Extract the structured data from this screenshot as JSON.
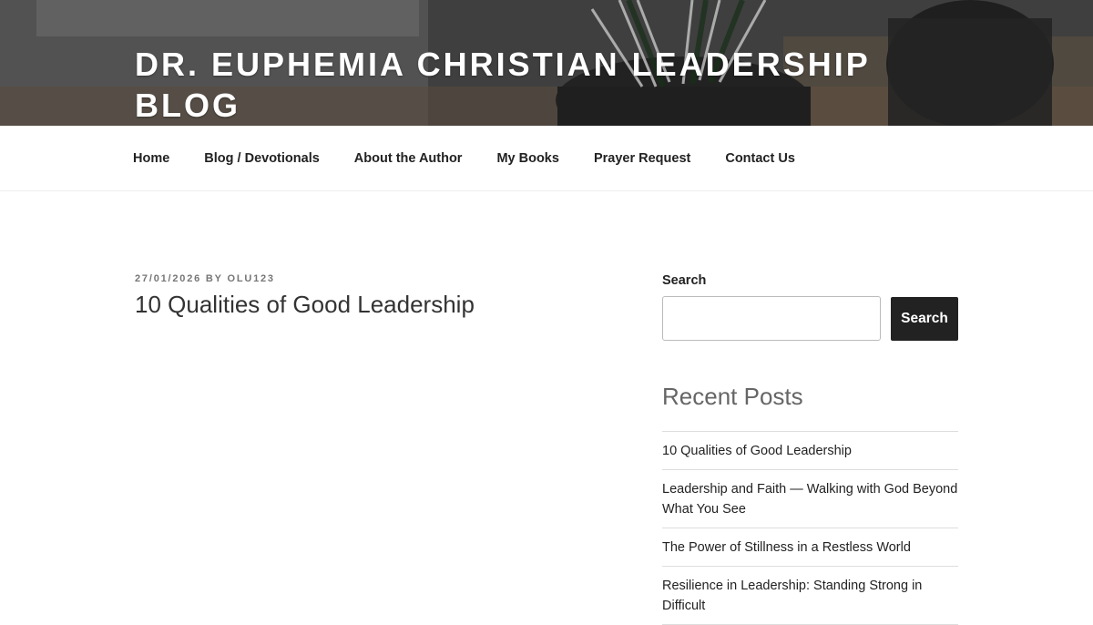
{
  "site": {
    "title": "DR. EUPHEMIA CHRISTIAN LEADERSHIP BLOG"
  },
  "nav": {
    "items": [
      {
        "label": "Home"
      },
      {
        "label": "Blog / Devotionals"
      },
      {
        "label": "About the Author"
      },
      {
        "label": "My Books"
      },
      {
        "label": "Prayer Request"
      },
      {
        "label": "Contact Us"
      }
    ]
  },
  "post": {
    "date": "27/01/2026",
    "by": "BY",
    "author": "OLU123",
    "title": "10 Qualities of Good Leadership"
  },
  "sidebar": {
    "search": {
      "label": "Search",
      "value": "",
      "placeholder": "",
      "button_label": "Search"
    },
    "recent_posts": {
      "title": "Recent Posts",
      "items": [
        {
          "label": "10 Qualities of Good Leadership"
        },
        {
          "label": "Leadership and Faith — Walking with God Beyond What You See"
        },
        {
          "label": "The Power of Stillness in a Restless World"
        },
        {
          "label": "Resilience in Leadership: Standing Strong in Difficult"
        }
      ]
    }
  },
  "colors": {
    "text": "#222222",
    "meta": "#767676",
    "button_bg": "#222222",
    "divider": "#dddddd"
  }
}
